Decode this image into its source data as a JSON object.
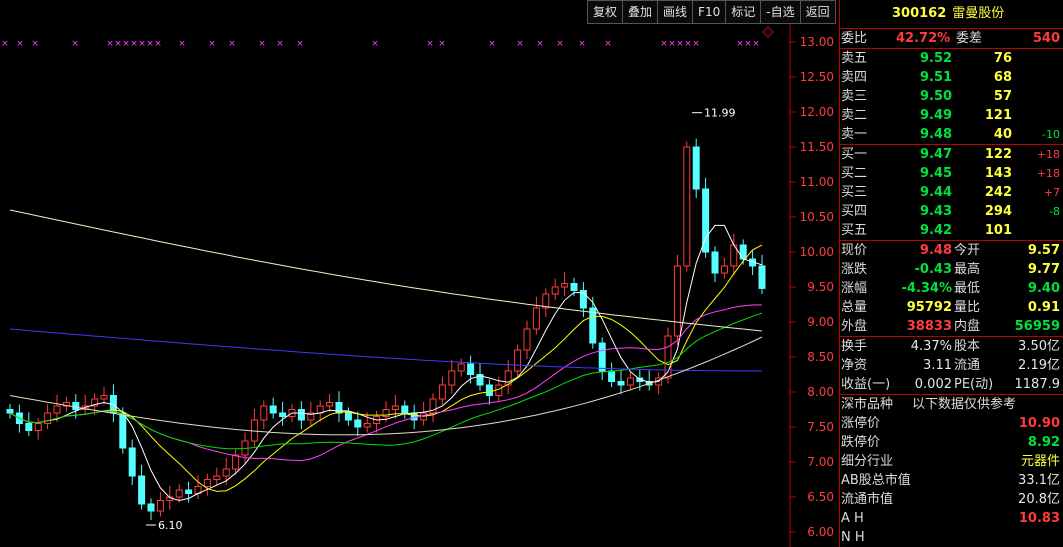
{
  "toolbar": {
    "buttons": [
      "复权",
      "叠加",
      "画线",
      "F10",
      "标记",
      "-自选",
      "返回"
    ]
  },
  "stock": {
    "code": "300162",
    "name": "雷曼股份"
  },
  "chart_data": {
    "type": "candlestick",
    "ylim": [
      6.0,
      13.0
    ],
    "y_ticks": [
      "13.00",
      "12.50",
      "12.00",
      "11.50",
      "11.00",
      "10.50",
      "10.00",
      "9.50",
      "9.00",
      "8.50",
      "8.00",
      "7.50",
      "7.00",
      "6.50",
      "6.00"
    ],
    "annotations": [
      {
        "label": "11.99",
        "value": 11.99
      },
      {
        "label": "6.10",
        "value": 6.1
      }
    ]
  },
  "orderbook": {
    "ratio": {
      "label": "委比",
      "value": "42.72%",
      "diff_label": "委差",
      "diff": "540"
    },
    "asks": [
      {
        "label": "卖五",
        "price": "9.52",
        "vol": "76",
        "chg": ""
      },
      {
        "label": "卖四",
        "price": "9.51",
        "vol": "68",
        "chg": ""
      },
      {
        "label": "卖三",
        "price": "9.50",
        "vol": "57",
        "chg": ""
      },
      {
        "label": "卖二",
        "price": "9.49",
        "vol": "121",
        "chg": ""
      },
      {
        "label": "卖一",
        "price": "9.48",
        "vol": "40",
        "chg": "-10"
      }
    ],
    "bids": [
      {
        "label": "买一",
        "price": "9.47",
        "vol": "122",
        "chg": "+18"
      },
      {
        "label": "买二",
        "price": "9.45",
        "vol": "143",
        "chg": "+18"
      },
      {
        "label": "买三",
        "price": "9.44",
        "vol": "242",
        "chg": "+7"
      },
      {
        "label": "买四",
        "price": "9.43",
        "vol": "294",
        "chg": "-8"
      },
      {
        "label": "买五",
        "price": "9.42",
        "vol": "101",
        "chg": ""
      }
    ]
  },
  "quote": {
    "rows": [
      {
        "l1": "现价",
        "v1": "9.48",
        "l2": "今开",
        "v2": "9.57"
      },
      {
        "l1": "涨跌",
        "v1": "-0.43",
        "l2": "最高",
        "v2": "9.77"
      },
      {
        "l1": "涨幅",
        "v1": "-4.34%",
        "l2": "最低",
        "v2": "9.40"
      },
      {
        "l1": "总量",
        "v1": "95792",
        "l2": "量比",
        "v2": "0.91"
      },
      {
        "l1": "外盘",
        "v1": "38833",
        "l2": "内盘",
        "v2": "56959"
      }
    ]
  },
  "fin": {
    "rows": [
      {
        "l1": "换手",
        "v1": "4.37%",
        "l2": "股本",
        "v2": "3.50亿"
      },
      {
        "l1": "净资",
        "v1": "3.11",
        "l2": "流通",
        "v2": "2.19亿"
      },
      {
        "l1": "收益(一)",
        "v1": "0.002",
        "l2": "PE(动)",
        "v2": "1187.9"
      }
    ]
  },
  "info": {
    "title": "深市品种",
    "note": "以下数据仅供参考",
    "limit_up_label": "涨停价",
    "limit_up": "10.90",
    "limit_down_label": "跌停价",
    "limit_down": "8.92",
    "industry_label": "细分行业",
    "industry": "元器件",
    "ab_cap_label": "AB股总市值",
    "ab_cap": "33.1亿",
    "float_cap_label": "流通市值",
    "float_cap": "20.8亿",
    "ah_label": "A H",
    "ah": "10.83",
    "nh_label": "N H"
  }
}
